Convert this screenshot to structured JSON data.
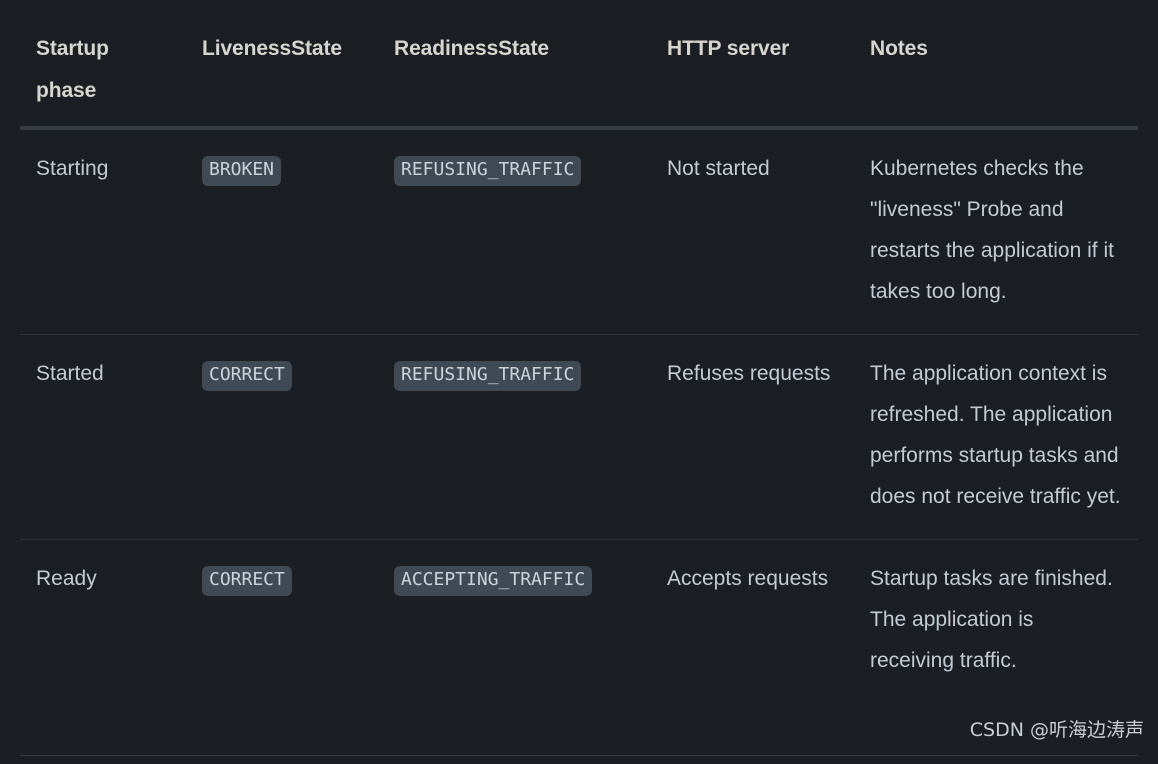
{
  "theme": {
    "page_background": "#1b1f24",
    "text_color": "#c3cbd3",
    "header_text_color": "#d8d5cf",
    "badge_background": "#3f4a55",
    "badge_text_color": "#ccd3da",
    "header_rule_color": "#363d45",
    "row_rule_color": "#2d343b"
  },
  "table": {
    "columns": [
      {
        "key": "startup_phase",
        "label": "Startup phase"
      },
      {
        "key": "liveness_state",
        "label": "LivenessState"
      },
      {
        "key": "readiness_state",
        "label": "ReadinessState"
      },
      {
        "key": "http_server",
        "label": "HTTP server"
      },
      {
        "key": "notes",
        "label": "Notes"
      }
    ],
    "rows": [
      {
        "startup_phase": "Starting",
        "liveness_state": "BROKEN",
        "readiness_state": "REFUSING_TRAFFIC",
        "http_server": "Not started",
        "notes": "Kubernetes checks the \"liveness\" Probe and restarts the application if it takes too long."
      },
      {
        "startup_phase": "Started",
        "liveness_state": "CORRECT",
        "readiness_state": "REFUSING_TRAFFIC",
        "http_server": "Refuses requests",
        "notes": "The application context is refreshed. The application performs startup tasks and does not receive traffic yet."
      },
      {
        "startup_phase": "Ready",
        "liveness_state": "CORRECT",
        "readiness_state": "ACCEPTING_TRAFFIC",
        "http_server": "Accepts requests",
        "notes": "Startup tasks are finished. The application is receiving traffic."
      }
    ]
  },
  "watermark": {
    "text": "CSDN @听海边涛声"
  }
}
